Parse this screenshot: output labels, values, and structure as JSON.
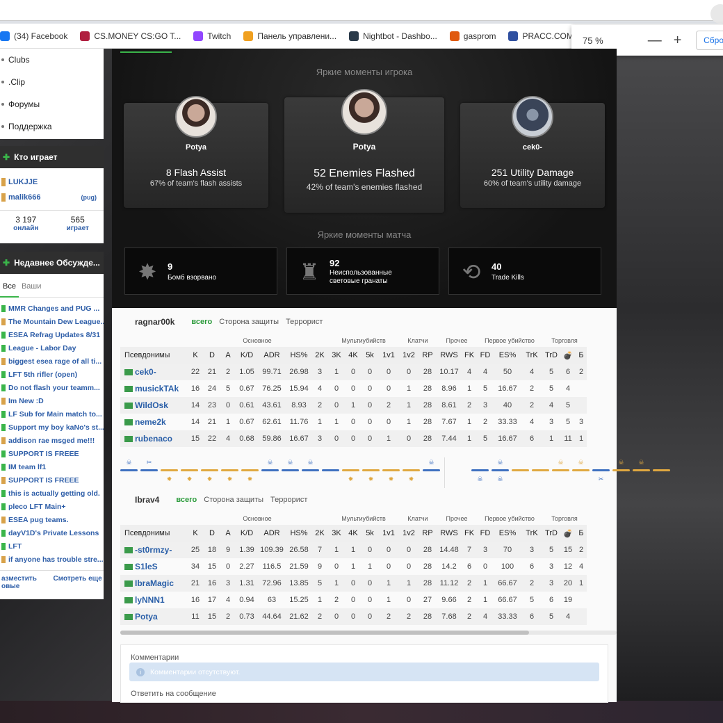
{
  "browser": {
    "bookmarks": [
      {
        "label": "(34) Facebook",
        "color": "#1877f2"
      },
      {
        "label": "CS.MONEY CS:GO T...",
        "color": "#b02040"
      },
      {
        "label": "Twitch",
        "color": "#9146ff"
      },
      {
        "label": "Панель управлени...",
        "color": "#f0a020"
      },
      {
        "label": "Nightbot - Dashbo...",
        "color": "#2a3a4a"
      },
      {
        "label": "gasprom",
        "color": "#e05a10"
      },
      {
        "label": "PRACC.COM -",
        "color": "#3050a0"
      }
    ],
    "zoom": {
      "value": "75 %",
      "minus": "—",
      "plus": "+",
      "reset": "Сбро"
    }
  },
  "sidebar": {
    "nav": [
      "Clubs",
      ".Clip",
      "Форумы",
      "Поддержка"
    ],
    "playing": {
      "title": "Кто играет",
      "players": [
        {
          "name": "LUKJJE",
          "tag": ""
        },
        {
          "name": "malik666",
          "tag": "(pug)"
        }
      ],
      "stats": [
        {
          "n": "3 197",
          "l": "онлайн"
        },
        {
          "n": "565",
          "l": "играет"
        }
      ]
    },
    "discussions": {
      "title": "Недавнее Обсужде...",
      "tabs": [
        "Все",
        "Ваши"
      ],
      "items": [
        "MMR Changes and PUG ...",
        "The Mountain Dew League...",
        "ESEA Refrag Updates 8/31",
        "League - Labor Day",
        "biggest esea rage of all ti...",
        "LFT 5th rifler (open)",
        "Do not flash your teamm...",
        "Im New :D",
        "LF Sub for Main match to...",
        "Support my boy kaNo's st...",
        "addison rae msged me!!!",
        "SUPPORT IS FREEE",
        "IM team lf1",
        "SUPPORT IS FREEE",
        "this is actually getting old.",
        "pleco LFT Main+",
        "ESEA pug teams.",
        "dayV1D's Private Lessons",
        "LFT",
        "if anyone has trouble stre..."
      ],
      "footer": [
        "азместить овые",
        "Смотреть еще"
      ]
    }
  },
  "highlights": {
    "player_title": "Яркие моменты игрока",
    "cards": [
      {
        "name": "Potya",
        "big": "8 Flash Assist",
        "small": "67% of team's flash assists"
      },
      {
        "name": "Potya",
        "big": "52 Enemies Flashed",
        "small": "42% of team's enemies flashed"
      },
      {
        "name": "cek0-",
        "big": "251 Utility Damage",
        "small": "60% of team's utility damage"
      }
    ],
    "match_title": "Яркие моменты матча",
    "match": [
      {
        "value": "9",
        "desc": "Бомб взорвано",
        "icon": "explosion-icon"
      },
      {
        "value": "92",
        "desc": "Неиспользованные световые гранаты",
        "icon": "flashbang-icon"
      },
      {
        "value": "40",
        "desc": "Trade Kills",
        "icon": "trade-arrows-icon"
      }
    ]
  },
  "filters": [
    "всего",
    "Сторона защиты",
    "Террорист"
  ],
  "table": {
    "groups": [
      "Основное",
      "Мультиубийств",
      "Клатчи",
      "Прочее",
      "Первое убийство",
      "Торговля"
    ],
    "columns": [
      "Псевдонимы",
      "K",
      "D",
      "A",
      "K/D",
      "ADR",
      "HS%",
      "2K",
      "3K",
      "4K",
      "5k",
      "1v1",
      "1v2",
      "RP",
      "RWS",
      "FK",
      "FD",
      "ES%",
      "TrK",
      "TrD",
      "💣",
      "Б"
    ]
  },
  "teams": [
    {
      "name": "ragnar00k",
      "rows": [
        [
          "cek0-",
          "22",
          "21",
          "2",
          "1.05",
          "99.71",
          "26.98",
          "3",
          "1",
          "0",
          "0",
          "0",
          "0",
          "28",
          "10.17",
          "4",
          "4",
          "50",
          "4",
          "5",
          "6",
          "2"
        ],
        [
          "musickTAk",
          "16",
          "24",
          "5",
          "0.67",
          "76.25",
          "15.94",
          "4",
          "0",
          "0",
          "0",
          "0",
          "1",
          "28",
          "8.96",
          "1",
          "5",
          "16.67",
          "2",
          "5",
          "4",
          ""
        ],
        [
          "WildOsk",
          "14",
          "23",
          "0",
          "0.61",
          "43.61",
          "8.93",
          "2",
          "0",
          "1",
          "0",
          "2",
          "1",
          "28",
          "8.61",
          "2",
          "3",
          "40",
          "2",
          "4",
          "5",
          ""
        ],
        [
          "neme2k",
          "14",
          "21",
          "1",
          "0.67",
          "62.61",
          "11.76",
          "1",
          "1",
          "0",
          "0",
          "0",
          "1",
          "28",
          "7.67",
          "1",
          "2",
          "33.33",
          "4",
          "3",
          "5",
          "3"
        ],
        [
          "rubenaco",
          "15",
          "22",
          "4",
          "0.68",
          "59.86",
          "16.67",
          "3",
          "0",
          "0",
          "0",
          "1",
          "0",
          "28",
          "7.44",
          "1",
          "5",
          "16.67",
          "6",
          "1",
          "11",
          "1"
        ]
      ]
    },
    {
      "name": "Ibrav4",
      "rows": [
        [
          "-st0rmzy-",
          "25",
          "18",
          "9",
          "1.39",
          "109.39",
          "26.58",
          "7",
          "1",
          "1",
          "0",
          "0",
          "0",
          "28",
          "14.48",
          "7",
          "3",
          "70",
          "3",
          "5",
          "15",
          "2"
        ],
        [
          "S1leS",
          "34",
          "15",
          "0",
          "2.27",
          "116.5",
          "21.59",
          "9",
          "0",
          "1",
          "1",
          "0",
          "0",
          "28",
          "14.2",
          "6",
          "0",
          "100",
          "6",
          "3",
          "12",
          "4"
        ],
        [
          "IbraMagic",
          "21",
          "16",
          "3",
          "1.31",
          "72.96",
          "13.85",
          "5",
          "1",
          "0",
          "0",
          "1",
          "1",
          "28",
          "11.12",
          "2",
          "1",
          "66.67",
          "2",
          "3",
          "20",
          "1"
        ],
        [
          "lyNNN1",
          "16",
          "17",
          "4",
          "0.94",
          "63",
          "15.25",
          "1",
          "2",
          "0",
          "0",
          "1",
          "0",
          "27",
          "9.66",
          "2",
          "1",
          "66.67",
          "5",
          "6",
          "19",
          ""
        ],
        [
          "Potya",
          "11",
          "15",
          "2",
          "0.73",
          "44.64",
          "21.62",
          "2",
          "0",
          "0",
          "0",
          "2",
          "2",
          "28",
          "7.68",
          "2",
          "4",
          "33.33",
          "6",
          "5",
          "4",
          ""
        ]
      ]
    }
  ],
  "rounds": {
    "top": [
      "skull-icon",
      "defuse-icon",
      "",
      "",
      "",
      "",
      "",
      "skull-icon",
      "skull-icon",
      "skull-icon",
      "",
      "",
      "",
      "",
      "",
      "skull-icon",
      "",
      "",
      "skull-icon",
      "",
      "",
      "skull-icon",
      "skull-icon",
      "",
      "skull-icon",
      "skull-icon",
      ""
    ],
    "bottom": [
      "",
      "",
      "explosion-icon",
      "explosion-icon",
      "explosion-icon",
      "explosion-icon",
      "explosion-icon",
      "",
      "",
      "",
      "",
      "explosion-icon",
      "explosion-icon",
      "explosion-icon",
      "explosion-icon",
      "",
      "",
      "skull-icon",
      "skull-icon",
      "",
      "",
      "",
      "",
      "defuse-icon",
      "",
      "",
      ""
    ],
    "colors": [
      "b",
      "b",
      "o",
      "o",
      "o",
      "o",
      "o",
      "b",
      "b",
      "b",
      "b",
      "o",
      "o",
      "o",
      "o",
      "b",
      "",
      "b",
      "b",
      "o",
      "o",
      "o",
      "o",
      "b",
      "o",
      "o",
      "o"
    ]
  },
  "comments": {
    "title": "Комментарии",
    "empty": "Комментарии отсутствуют.",
    "reply": "Ответить на сообщение"
  }
}
